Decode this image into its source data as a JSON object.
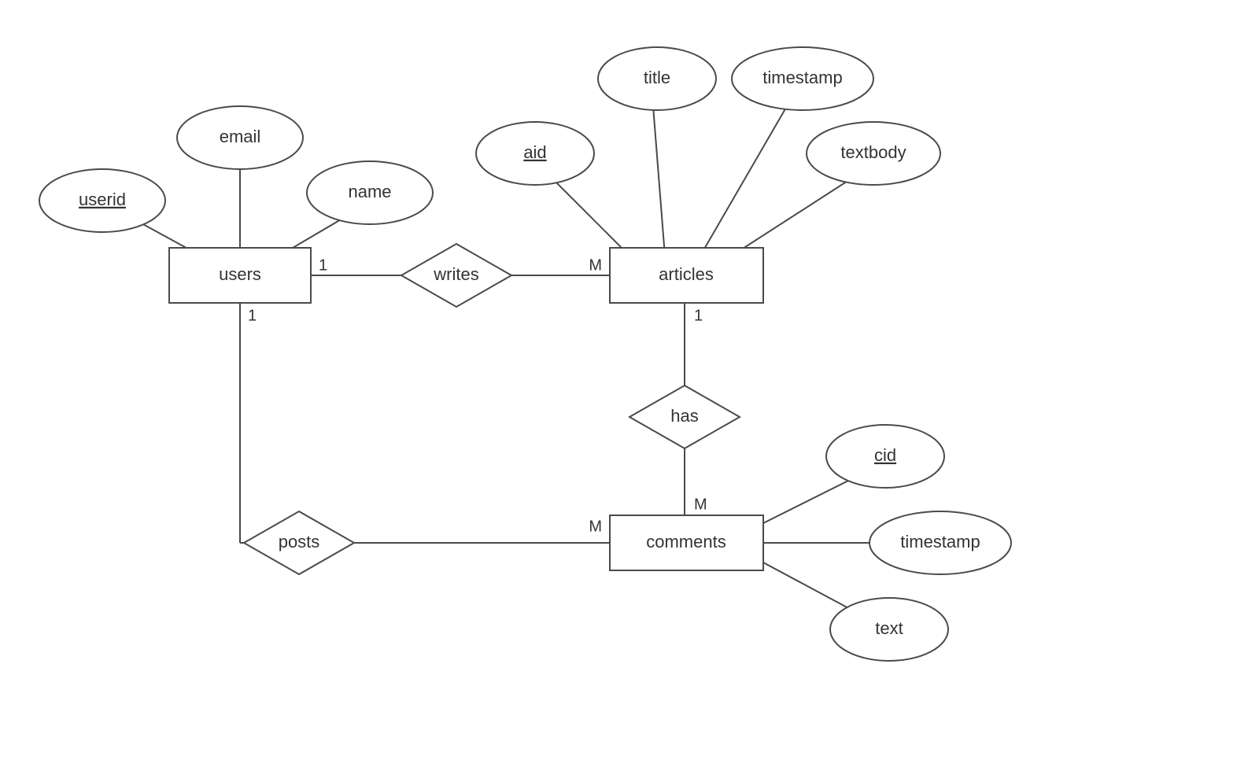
{
  "diagram": {
    "entities": {
      "users": {
        "label": "users"
      },
      "articles": {
        "label": "articles"
      },
      "comments": {
        "label": "comments"
      }
    },
    "relationships": {
      "writes": {
        "label": "writes"
      },
      "has": {
        "label": "has"
      },
      "posts": {
        "label": "posts"
      }
    },
    "attributes": {
      "userid": {
        "label": "userid",
        "key": true
      },
      "email": {
        "label": "email",
        "key": false
      },
      "name": {
        "label": "name",
        "key": false
      },
      "aid": {
        "label": "aid",
        "key": true
      },
      "title": {
        "label": "title",
        "key": false
      },
      "a_timestamp": {
        "label": "timestamp",
        "key": false
      },
      "textbody": {
        "label": "textbody",
        "key": false
      },
      "cid": {
        "label": "cid",
        "key": true
      },
      "c_timestamp": {
        "label": "timestamp",
        "key": false
      },
      "text": {
        "label": "text",
        "key": false
      }
    },
    "cardinalities": {
      "users_writes": "1",
      "writes_articles": "M",
      "users_posts": "1",
      "articles_has": "1",
      "has_comments": "M",
      "posts_comments": "M"
    }
  }
}
